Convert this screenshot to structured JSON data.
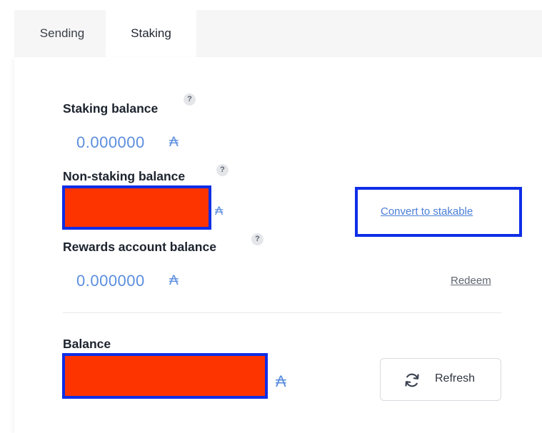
{
  "tabs": {
    "sending": "Sending",
    "staking": "Staking"
  },
  "staking_balance": {
    "label": "Staking balance",
    "help": "?",
    "value": "0.000000",
    "unit": "₳"
  },
  "non_staking_balance": {
    "label": "Non-staking balance",
    "help": "?",
    "unit": "₳",
    "action": "Convert to stakable"
  },
  "rewards_balance": {
    "label": "Rewards account balance",
    "help": "?",
    "value": "0.000000",
    "unit": "₳",
    "action": "Redeem"
  },
  "balance": {
    "label": "Balance",
    "unit": "₳"
  },
  "refresh_button": {
    "label": "Refresh",
    "icon": "refresh-icon"
  },
  "colors": {
    "value_blue": "#5b8ede",
    "redaction_fill": "#fe3400",
    "annotation_border": "#0e2ee6"
  }
}
